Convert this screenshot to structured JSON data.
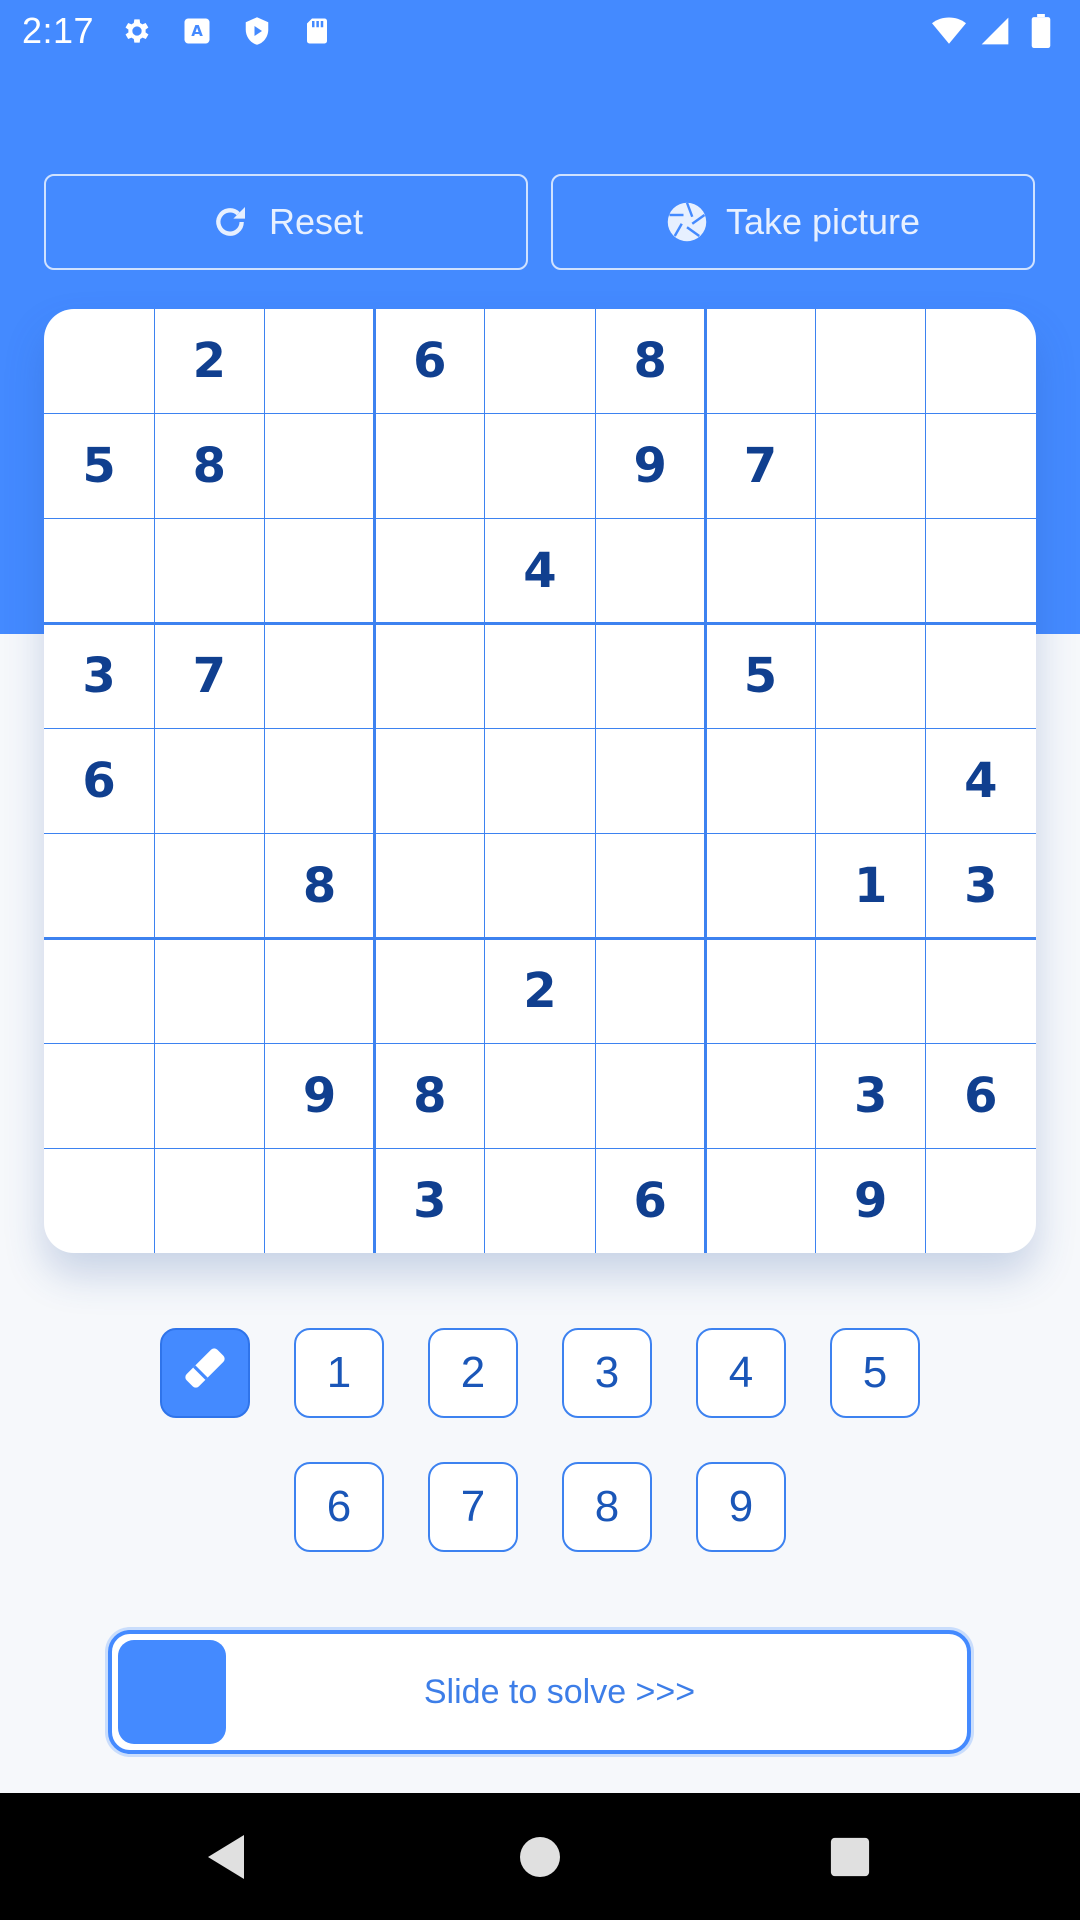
{
  "status_bar": {
    "time": "2:17",
    "icons": [
      "gear-icon",
      "text-a-icon",
      "shield-play-icon",
      "sd-card-icon"
    ],
    "right_icons": [
      "wifi-icon",
      "signal-icon",
      "battery-icon"
    ]
  },
  "toolbar": {
    "reset_label": "Reset",
    "reset_icon": "refresh-icon",
    "picture_label": "Take picture",
    "picture_icon": "camera-aperture-icon"
  },
  "board": {
    "grid": [
      [
        "",
        "2",
        "",
        "6",
        "",
        "8",
        "",
        "",
        ""
      ],
      [
        "5",
        "8",
        "",
        "",
        "",
        "9",
        "7",
        "",
        ""
      ],
      [
        "",
        "",
        "",
        "",
        "4",
        "",
        "",
        "",
        ""
      ],
      [
        "3",
        "7",
        "",
        "",
        "",
        "",
        "5",
        "",
        ""
      ],
      [
        "6",
        "",
        "",
        "",
        "",
        "",
        "",
        "",
        "4"
      ],
      [
        "",
        "",
        "8",
        "",
        "",
        "",
        "",
        "1",
        "3"
      ],
      [
        "",
        "",
        "",
        "",
        "2",
        "",
        "",
        "",
        ""
      ],
      [
        "",
        "",
        "9",
        "8",
        "",
        "",
        "",
        "3",
        "6"
      ],
      [
        "",
        "",
        "",
        "3",
        "",
        "6",
        "",
        "9",
        ""
      ]
    ]
  },
  "number_pad": {
    "eraser_icon": "eraser-icon",
    "row1": [
      "1",
      "2",
      "3",
      "4",
      "5"
    ],
    "row2": [
      "6",
      "7",
      "8",
      "9"
    ]
  },
  "slider": {
    "label": "Slide to solve >>>"
  },
  "nav_bar": {
    "icons": [
      "back-triangle-icon",
      "home-circle-icon",
      "recents-square-icon"
    ]
  },
  "colors": {
    "primary": "#448aff",
    "digit": "#103f8f",
    "grid_line": "#3d82f0"
  }
}
